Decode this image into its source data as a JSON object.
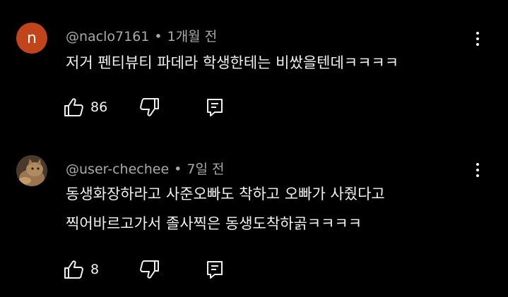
{
  "comments": [
    {
      "avatar": {
        "letter": "n",
        "color": "#c1441a"
      },
      "author": "@naclo7161",
      "separator": "•",
      "time": "1개월 전",
      "lines": [
        "저거 펜티뷰티 파데라 학생한테는 비쌌을텐데ㅋㅋㅋㅋ"
      ],
      "likes": "86"
    },
    {
      "avatar": {
        "letter": "",
        "color": "#8a6a4a"
      },
      "author": "@user-chechee",
      "separator": "•",
      "time": "7일 전",
      "lines": [
        "동생화장하라고 사준오빠도 착하고 오빠가 사줬다고",
        "찍어바르고가서 졸사찍은  동생도착하곩ㅋㅋㅋㅋ"
      ],
      "likes": "8"
    }
  ],
  "icons": {
    "like": "thumbs-up-icon",
    "dislike": "thumbs-down-icon",
    "reply": "reply-comment-icon",
    "menu": "more-vertical-icon"
  }
}
